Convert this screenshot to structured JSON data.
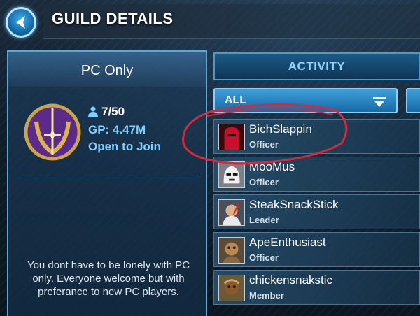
{
  "header": {
    "title": "GUILD DETAILS",
    "back_icon": "back-arrow-icon"
  },
  "guild": {
    "name": "PC Only",
    "members": "7/50",
    "gp": "GP: 4.47M",
    "status": "Open to Join",
    "description": "You dont have to be lonely with PC only. Everyone welcome but with preferance to new PC players."
  },
  "activity": {
    "tab_label": "ACTIVITY",
    "filter_label": "ALL"
  },
  "members_list": [
    {
      "name": "BichSlappin",
      "role": "Officer",
      "avatar": "red-guard-avatar"
    },
    {
      "name": "MooMus",
      "role": "Officer",
      "avatar": "stormtrooper-avatar"
    },
    {
      "name": "SteakSnackStick",
      "role": "Leader",
      "avatar": "fighter-avatar"
    },
    {
      "name": "ApeEnthusiast",
      "role": "Officer",
      "avatar": "alien-avatar"
    },
    {
      "name": "chickensnakstic",
      "role": "Member",
      "avatar": "ewok-avatar"
    }
  ],
  "colors": {
    "accent": "#7fd0ff",
    "annotation": "#d8283a",
    "panel_border": "#5ea9d4"
  }
}
